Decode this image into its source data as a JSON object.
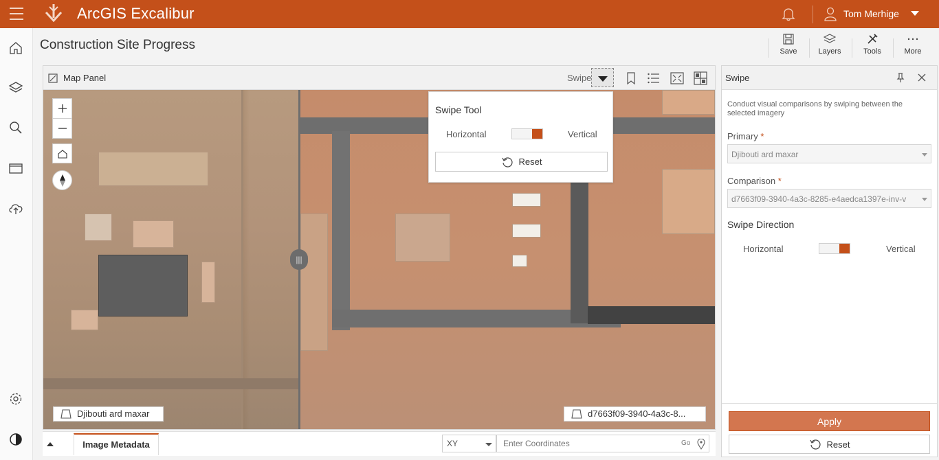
{
  "header": {
    "app_title": "ArcGIS Excalibur",
    "user_name": "Tom Merhige",
    "brand_color": "#c4501a"
  },
  "rail": {
    "items": [
      "home-icon",
      "layers-icon",
      "search-icon",
      "folder-icon",
      "upload-icon",
      "gear-icon",
      "contrast-icon"
    ]
  },
  "page": {
    "title": "Construction Site Progress"
  },
  "toolbar": {
    "save_label": "Save",
    "layers_label": "Layers",
    "tools_label": "Tools",
    "more_label": "More"
  },
  "map_panel": {
    "title": "Map Panel",
    "swipe_label": "Swipe",
    "left_layer": "Djibouti ard maxar",
    "right_layer": "d7663f09-3940-4a3c-8..."
  },
  "swipe_tool": {
    "title": "Swipe Tool",
    "horizontal": "Horizontal",
    "vertical": "Vertical",
    "reset": "Reset"
  },
  "bottom_bar": {
    "tab_label": "Image Metadata",
    "coord_system": "XY",
    "coord_placeholder": "Enter Coordinates",
    "go_label": "Go"
  },
  "side_panel": {
    "title": "Swipe",
    "description": "Conduct visual comparisons by swiping between the selected imagery",
    "primary_label": "Primary",
    "primary_value": "Djibouti ard maxar",
    "comparison_label": "Comparison",
    "comparison_value": "d7663f09-3940-4a3c-8285-e4aedca1397e-inv-v",
    "required_mark": "*",
    "direction_heading": "Swipe Direction",
    "horizontal": "Horizontal",
    "vertical": "Vertical",
    "apply": "Apply",
    "reset": "Reset"
  }
}
